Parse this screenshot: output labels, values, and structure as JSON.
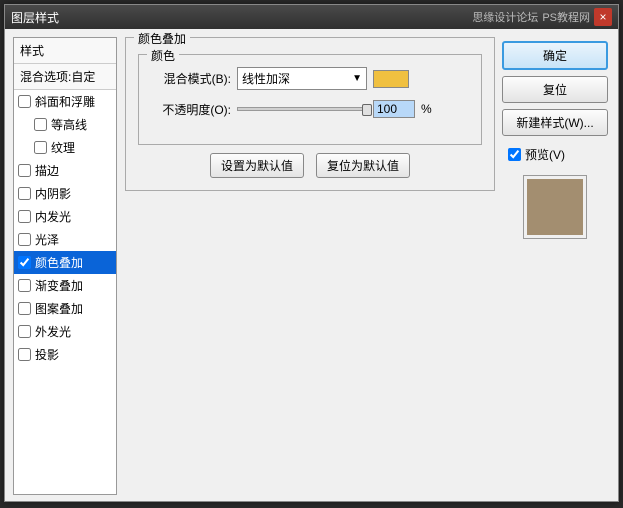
{
  "titlebar": {
    "title": "图层样式",
    "watermark1": "思缘设计论坛",
    "watermark2": "PS教程网",
    "close": "×"
  },
  "sidebar": {
    "header": "样式",
    "subheader": "混合选项:自定",
    "items": [
      {
        "label": "斜面和浮雕",
        "checked": false,
        "indent": false
      },
      {
        "label": "等高线",
        "checked": false,
        "indent": true
      },
      {
        "label": "纹理",
        "checked": false,
        "indent": true
      },
      {
        "label": "描边",
        "checked": false,
        "indent": false
      },
      {
        "label": "内阴影",
        "checked": false,
        "indent": false
      },
      {
        "label": "内发光",
        "checked": false,
        "indent": false
      },
      {
        "label": "光泽",
        "checked": false,
        "indent": false
      },
      {
        "label": "颜色叠加",
        "checked": true,
        "indent": false,
        "selected": true
      },
      {
        "label": "渐变叠加",
        "checked": false,
        "indent": false
      },
      {
        "label": "图案叠加",
        "checked": false,
        "indent": false
      },
      {
        "label": "外发光",
        "checked": false,
        "indent": false
      },
      {
        "label": "投影",
        "checked": false,
        "indent": false
      }
    ]
  },
  "panel": {
    "title": "颜色叠加",
    "innerTitle": "颜色",
    "blendModeLabel": "混合模式(B):",
    "blendModeValue": "线性加深",
    "opacityLabel": "不透明度(O):",
    "opacityValue": "100",
    "opacityUnit": "%",
    "defaultBtn": "设置为默认值",
    "resetBtn": "复位为默认值",
    "swatchColor": "#f0c040"
  },
  "right": {
    "ok": "确定",
    "reset": "复位",
    "newStyle": "新建样式(W)...",
    "previewLabel": "预览(V)",
    "previewChecked": true,
    "previewColor": "#a38e70"
  }
}
